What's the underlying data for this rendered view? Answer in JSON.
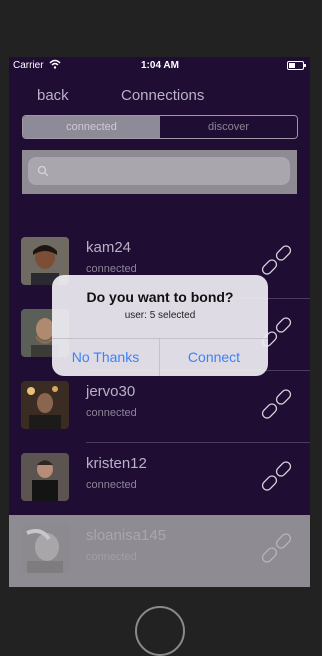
{
  "status_bar": {
    "carrier": "Carrier",
    "time": "1:04 AM"
  },
  "nav": {
    "back_label": "back",
    "title": "Connections"
  },
  "tabs": [
    {
      "label": "connected",
      "active": true
    },
    {
      "label": "discover",
      "active": false
    }
  ],
  "search": {
    "placeholder": ""
  },
  "connections": [
    {
      "username": "kam24",
      "status": "connected"
    },
    {
      "username": "",
      "status": ""
    },
    {
      "username": "jervo30",
      "status": "connected"
    },
    {
      "username": "kristen12",
      "status": "connected"
    },
    {
      "username": "sloanisa145",
      "status": "connected"
    }
  ],
  "alert": {
    "title": "Do you want to bond?",
    "message": "user: 5 selected",
    "cancel_label": "No Thanks",
    "confirm_label": "Connect"
  },
  "colors": {
    "background": "#1f0d33",
    "accent_blue": "#3b82f6",
    "overlay_gray": "#8e8b92"
  },
  "icons": [
    "wifi-icon",
    "battery-icon",
    "search-icon",
    "link-icon",
    "home-button"
  ]
}
